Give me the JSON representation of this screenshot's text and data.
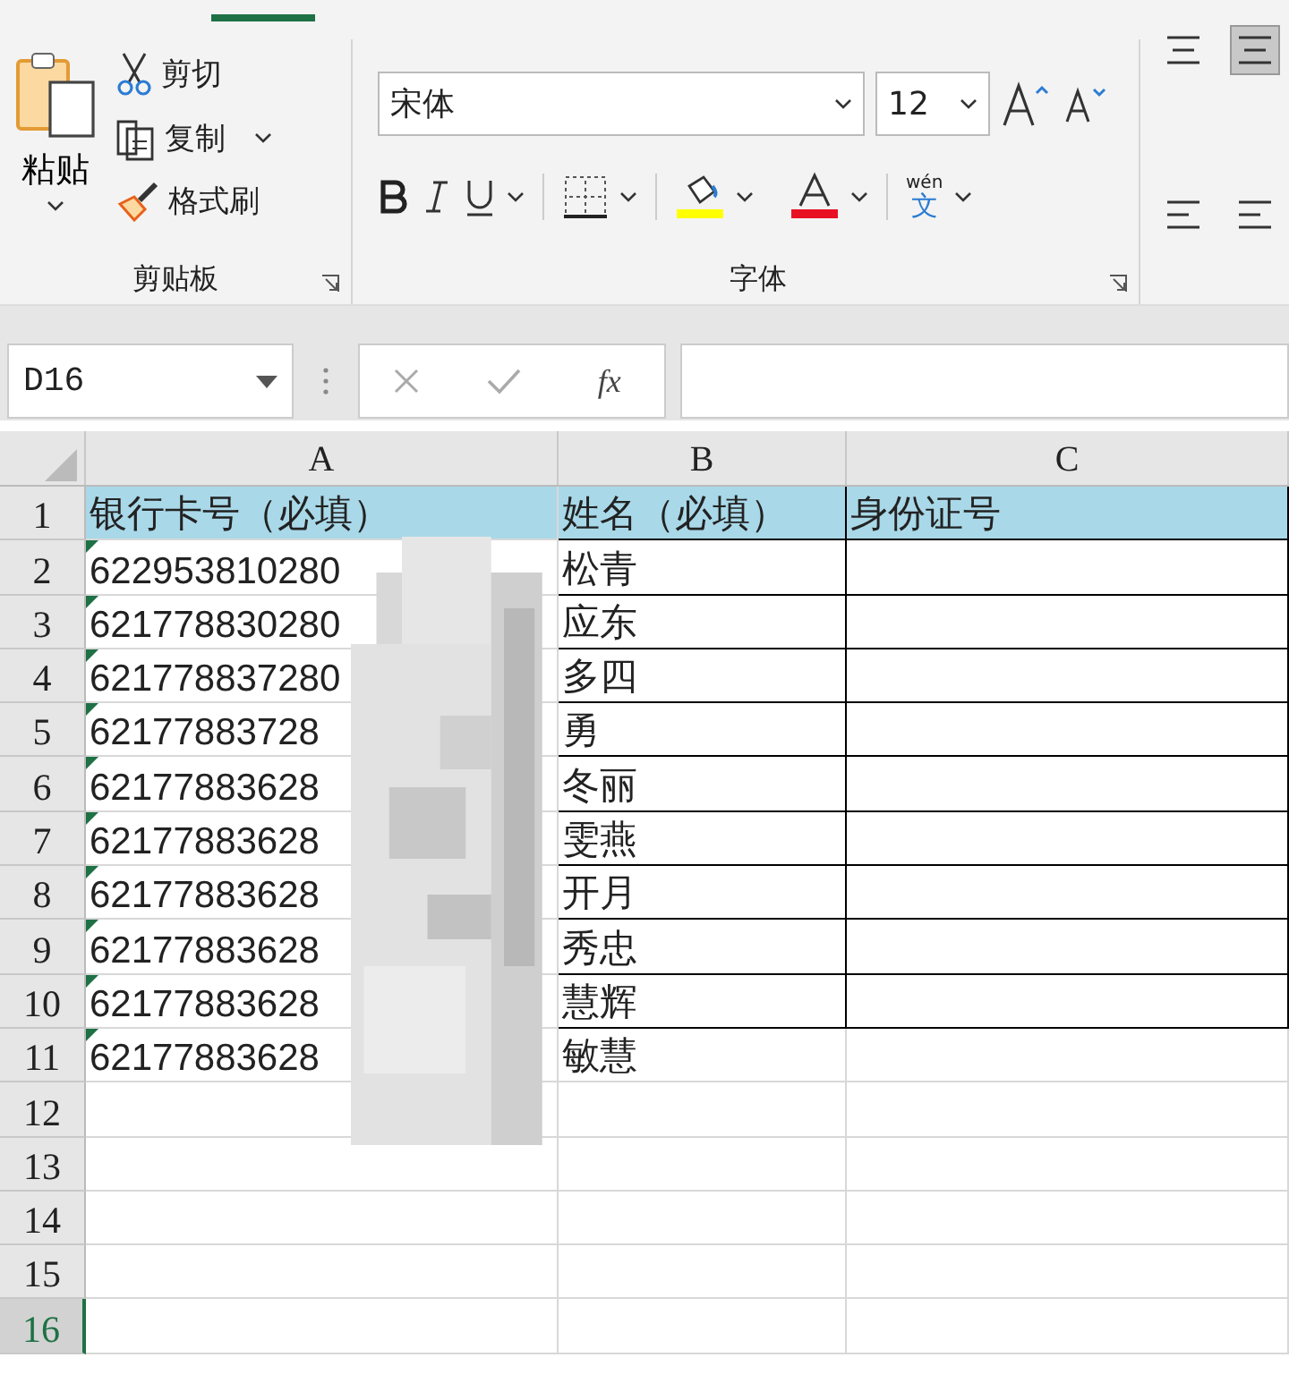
{
  "ribbon": {
    "active_tab_indicator": true,
    "clipboard": {
      "paste": "粘贴",
      "cut": "剪切",
      "copy": "复制",
      "format_painter": "格式刷",
      "label": "剪贴板"
    },
    "font": {
      "font_name": "宋体",
      "font_size": "12",
      "label": "字体",
      "phonetic": "wén",
      "phonetic_char": "文"
    }
  },
  "formula_bar": {
    "name_box": "D16",
    "fx": "fx"
  },
  "columns": [
    {
      "label": "A"
    },
    {
      "label": "B"
    },
    {
      "label": "C"
    }
  ],
  "rows": [
    {
      "num": "1",
      "a": "银行卡号（必填）",
      "b": "姓名（必填）",
      "c": "身份证号",
      "header": true,
      "flag": false,
      "bordered": true,
      "selected": false
    },
    {
      "num": "2",
      "a": "622953810280",
      "b": "松青",
      "header": false,
      "flag": true,
      "bordered": true,
      "selected": false
    },
    {
      "num": "3",
      "a": "621778830280",
      "b": "应东",
      "header": false,
      "flag": true,
      "bordered": true,
      "selected": false
    },
    {
      "num": "4",
      "a": "621778837280",
      "b": "多四",
      "header": false,
      "flag": true,
      "bordered": true,
      "selected": false
    },
    {
      "num": "5",
      "a": "62177883728",
      "b": "勇",
      "header": false,
      "flag": true,
      "bordered": true,
      "selected": false
    },
    {
      "num": "6",
      "a": "62177883628",
      "b": "冬丽",
      "header": false,
      "flag": true,
      "bordered": true,
      "selected": false
    },
    {
      "num": "7",
      "a": "62177883628",
      "b": "雯燕",
      "header": false,
      "flag": true,
      "bordered": true,
      "selected": false
    },
    {
      "num": "8",
      "a": "62177883628",
      "b": "开月",
      "header": false,
      "flag": true,
      "bordered": true,
      "selected": false
    },
    {
      "num": "9",
      "a": "62177883628",
      "b": "秀忠",
      "header": false,
      "flag": true,
      "bordered": true,
      "selected": false
    },
    {
      "num": "10",
      "a": "62177883628",
      "b": "慧辉",
      "header": false,
      "flag": true,
      "bordered": true,
      "selected": false
    },
    {
      "num": "11",
      "a": "62177883628",
      "b": "敏慧",
      "header": false,
      "flag": true,
      "bordered": false,
      "selected": false
    },
    {
      "num": "12",
      "header": false,
      "flag": false,
      "bordered": false,
      "selected": false
    },
    {
      "num": "13",
      "header": false,
      "flag": false,
      "bordered": false,
      "selected": false
    },
    {
      "num": "14",
      "header": false,
      "flag": false,
      "bordered": false,
      "selected": false
    },
    {
      "num": "15",
      "header": false,
      "flag": false,
      "bordered": false,
      "selected": false
    },
    {
      "num": "16",
      "header": false,
      "flag": false,
      "bordered": false,
      "selected": true
    }
  ],
  "redaction": true
}
